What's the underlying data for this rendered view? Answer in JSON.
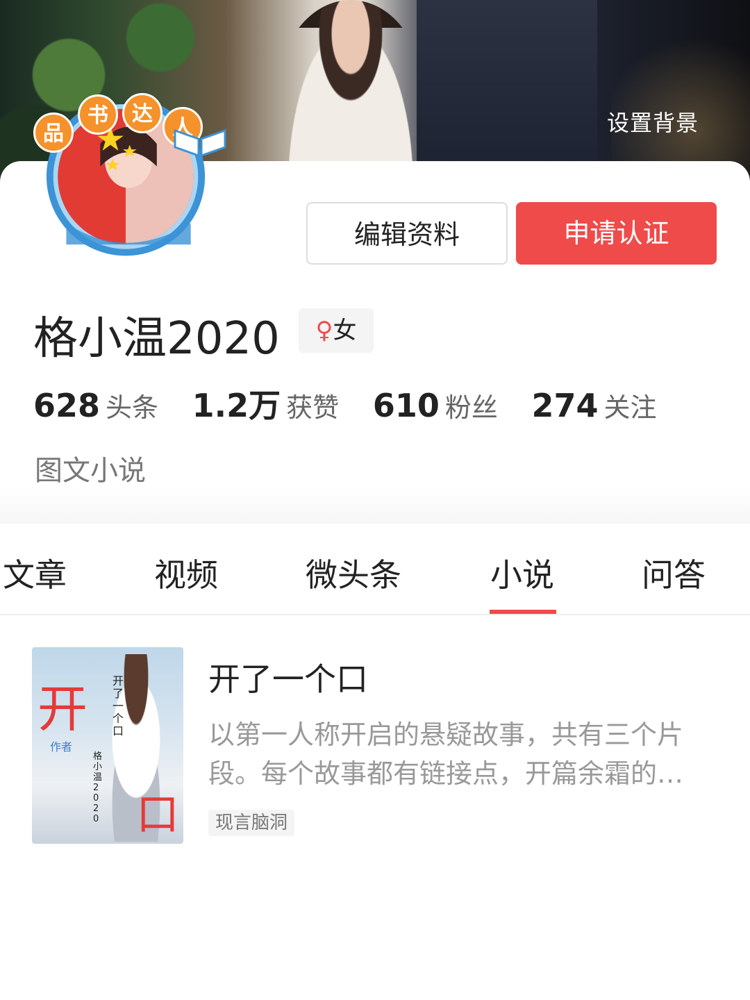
{
  "header": {
    "set_background": "设置背景"
  },
  "badge": {
    "chars": [
      "品",
      "书",
      "达",
      "人"
    ]
  },
  "actions": {
    "edit_label": "编辑资料",
    "verify_label": "申请认证"
  },
  "profile": {
    "name": "格小温2020",
    "gender_symbol": "♀",
    "gender": "女",
    "intro": "图文小说"
  },
  "stats": [
    {
      "value": "628",
      "label": "头条"
    },
    {
      "value": "1.2万",
      "label": "获赞"
    },
    {
      "value": "610",
      "label": "粉丝"
    },
    {
      "value": "274",
      "label": "关注"
    }
  ],
  "tabs": [
    "文章",
    "视频",
    "微头条",
    "小说",
    "问答"
  ],
  "active_tab": "小说",
  "novel": {
    "title": "开了一个口",
    "description": "以第一人称开启的悬疑故事，共有三个片段。每个故事都有链接点，开篇余霜的…",
    "tag": "现言脑洞",
    "cover_text": {
      "big_left": "开",
      "big_right": "口",
      "author": "格小温2020",
      "author_label": "作者",
      "vertical": "开了一个口"
    }
  },
  "colors": {
    "accent": "#ef4b4b",
    "badge_orange": "#f5922b",
    "ring_blue": "#3c93d6"
  }
}
